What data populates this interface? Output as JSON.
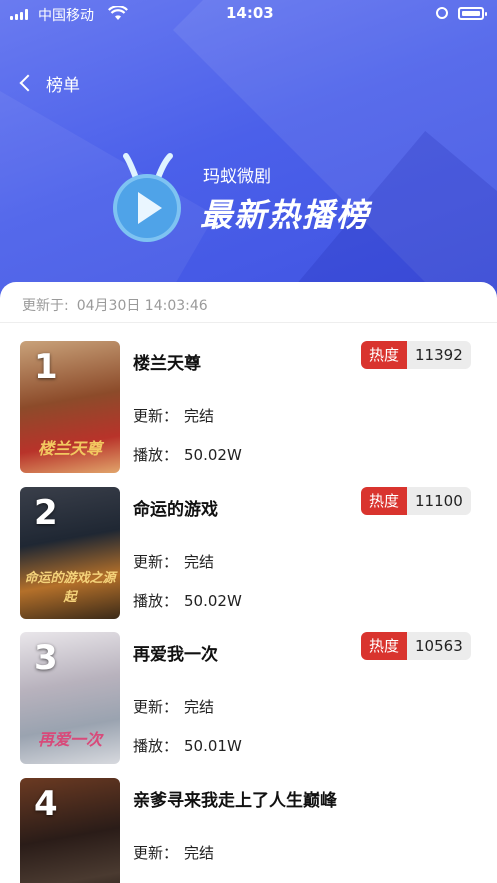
{
  "status_bar": {
    "carrier": "中国移动",
    "time": "14:03"
  },
  "nav": {
    "title": "榜单"
  },
  "banner": {
    "brand": "玛蚁微剧",
    "title": "最新热播榜"
  },
  "updated": {
    "label": "更新于:",
    "timestamp": "04月30日 14:03:46"
  },
  "labels": {
    "update": "更新：",
    "plays": "播放：",
    "heat": "热度"
  },
  "colors": {
    "accent": "#d9342e",
    "hero": "#4b60ea"
  },
  "items": [
    {
      "rank": "1",
      "name": "楼兰天尊",
      "status": "完结",
      "plays": "50.02W",
      "heat": "11392",
      "cover_text": "楼兰天尊"
    },
    {
      "rank": "2",
      "name": "命运的游戏",
      "status": "完结",
      "plays": "50.02W",
      "heat": "11100",
      "cover_text": "命运的游戏之源起"
    },
    {
      "rank": "3",
      "name": "再爱我一次",
      "status": "完结",
      "plays": "50.01W",
      "heat": "10563",
      "cover_text": "再爱一次"
    },
    {
      "rank": "4",
      "name": "亲爹寻来我走上了人生巅峰",
      "status": "完结",
      "plays": "",
      "heat": "",
      "cover_text": ""
    }
  ]
}
